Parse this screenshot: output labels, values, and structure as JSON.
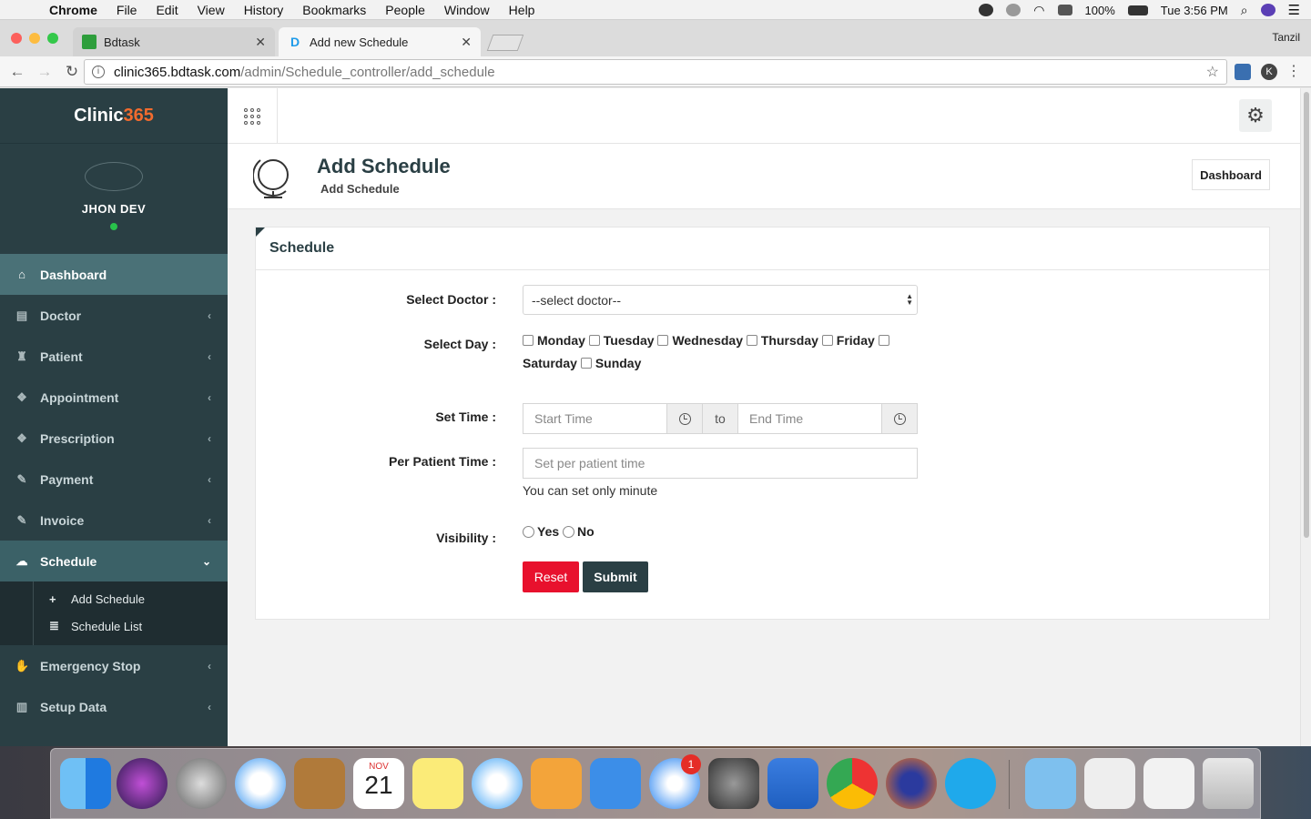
{
  "menubar": {
    "app": "Chrome",
    "items": [
      "File",
      "Edit",
      "View",
      "History",
      "Bookmarks",
      "People",
      "Window",
      "Help"
    ],
    "battery": "100%",
    "clock": "Tue 3:56 PM"
  },
  "browser": {
    "tabs": [
      {
        "title": "Bdtask",
        "favicon_color": "#2e9e3c"
      },
      {
        "title": "Add new Schedule",
        "favicon_letter": "D"
      }
    ],
    "profile": "Tanzil",
    "url_host": "clinic365.bdtask.com",
    "url_path": "/admin/Schedule_controller/add_schedule",
    "ext_letter": "K"
  },
  "sidebar": {
    "logo_main": "Clinic",
    "logo_num": "365",
    "user_name": "JHON DEV",
    "items": [
      {
        "label": "Dashboard",
        "icon": "home-icon",
        "glyph": "⌂"
      },
      {
        "label": "Doctor",
        "icon": "file-icon",
        "glyph": "▤"
      },
      {
        "label": "Patient",
        "icon": "person-icon",
        "glyph": "♜"
      },
      {
        "label": "Appointment",
        "icon": "cube-icon",
        "glyph": "❖"
      },
      {
        "label": "Prescription",
        "icon": "cube-icon",
        "glyph": "❖"
      },
      {
        "label": "Payment",
        "icon": "tag-icon",
        "glyph": "✎"
      },
      {
        "label": "Invoice",
        "icon": "tag-icon",
        "glyph": "✎"
      },
      {
        "label": "Schedule",
        "icon": "wechat-icon",
        "glyph": "☁"
      },
      {
        "label": "Emergency Stop",
        "icon": "hand-icon",
        "glyph": "✋"
      },
      {
        "label": "Setup Data",
        "icon": "bar-chart-icon",
        "glyph": "▥"
      }
    ],
    "sub_items": [
      {
        "label": "Add Schedule",
        "glyph": "+"
      },
      {
        "label": "Schedule List",
        "glyph": "≣"
      }
    ]
  },
  "header": {
    "title": "Add Schedule",
    "subtitle": "Add Schedule",
    "breadcrumb": "Dashboard"
  },
  "form": {
    "panel_title": "Schedule",
    "doctor_label": "Select Doctor :",
    "doctor_value": "--select doctor--",
    "day_label": "Select Day :",
    "days": [
      "Monday",
      "Tuesday",
      "Wednesday",
      "Thursday",
      "Friday",
      "Saturday",
      "Sunday"
    ],
    "time_label": "Set Time :",
    "start_placeholder": "Start Time",
    "to_label": "to",
    "end_placeholder": "End Time",
    "per_patient_label": "Per Patient Time :",
    "per_patient_placeholder": "Set per patient time",
    "help_text": "You can set only minute",
    "visibility_label": "Visibility :",
    "yes_label": "Yes",
    "no_label": "No",
    "reset_label": "Reset",
    "submit_label": "Submit"
  },
  "dock": {
    "calendar_month": "NOV",
    "calendar_day": "21",
    "appstore_badge": "1"
  },
  "colors": {
    "sidebar_bg": "#2a3f44",
    "active_item": "#4a7177",
    "accent_orange": "#f26b2e",
    "reset_red": "#e8112d",
    "online_green": "#28c24b"
  }
}
